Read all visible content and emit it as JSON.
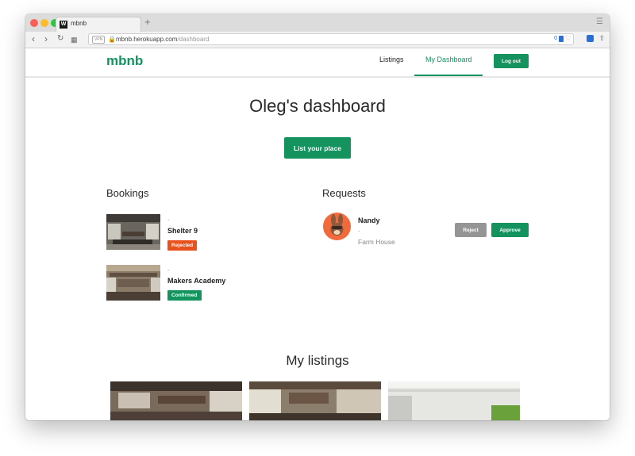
{
  "browser": {
    "tab_title": "mbnb",
    "tab_favicon": "W",
    "new_tab": "+",
    "vpn_badge": "VPN",
    "url_host": "mbnb.herokuapp.com",
    "url_path": "/dashboard",
    "extension_count": "0"
  },
  "site": {
    "logo": "mbnb",
    "nav": {
      "listings": "Listings",
      "dashboard": "My Dashboard",
      "logout": "Log out"
    },
    "accent_color": "#14935f"
  },
  "dashboard": {
    "title": "Oleg's dashboard",
    "list_button": "List your place",
    "bookings_heading": "Bookings",
    "bookings": [
      {
        "dash": "-",
        "name": "Shelter 9",
        "status": "Rejected",
        "status_color": "#e8501c"
      },
      {
        "dash": "-",
        "name": "Makers Academy",
        "status": "Confirmed",
        "status_color": "#14935f"
      }
    ],
    "requests_heading": "Requests",
    "requests": [
      {
        "name": "Nandy",
        "dash": "-",
        "place": "Farm House",
        "reject": "Reject",
        "approve": "Approve"
      }
    ],
    "listings_heading": "My listings"
  }
}
